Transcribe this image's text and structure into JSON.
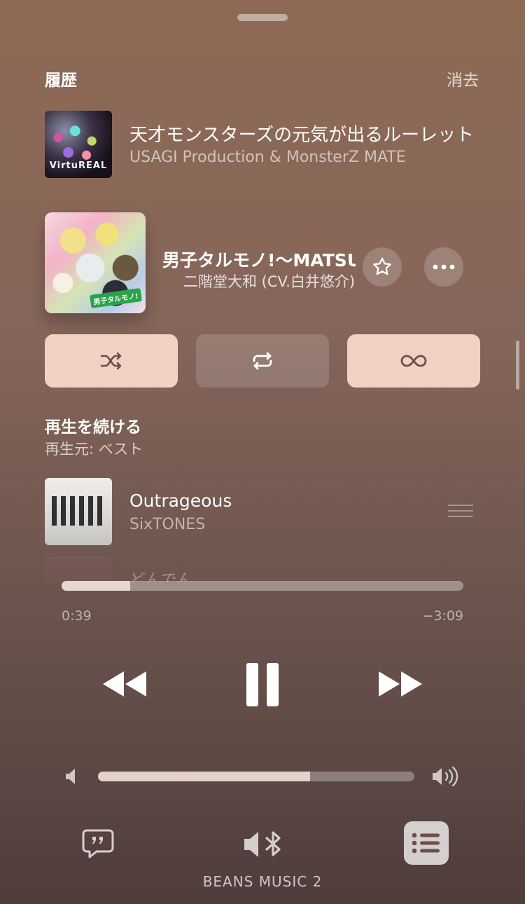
{
  "history": {
    "title": "履歴",
    "clear_label": "消去",
    "item": {
      "title": "天才モンスターズの元気が出るルーレット",
      "artist": "USAGI Production & MonsterZ MATE",
      "art_text": "VirtuREAL"
    }
  },
  "now_playing": {
    "title": "男子タルモノ!〜MATSURI〜",
    "artist": "二階堂大和 (CV.白井悠介)",
    "art_stamp": "男子タルモノ!"
  },
  "modes": {
    "shuffle": {
      "icon": "shuffle-icon",
      "active": true
    },
    "repeat": {
      "icon": "repeat-icon",
      "active": false
    },
    "autoplay": {
      "icon": "infinity-icon",
      "active": true
    }
  },
  "continue": {
    "title": "再生を続ける",
    "subtitle": "再生元: ベスト",
    "items": [
      {
        "title": "Outrageous",
        "artist": "SixTONES"
      },
      {
        "title": "どんでん"
      }
    ]
  },
  "playback": {
    "elapsed": "0:39",
    "remaining": "−3:09",
    "progress_fraction": 0.17
  },
  "volume": {
    "level_fraction": 0.67
  },
  "device": {
    "name": "BEANS MUSIC 2"
  },
  "colors": {
    "accent_button": "#efd2c4",
    "background_top": "#8e6a55",
    "background_bottom": "#4f3d3b"
  }
}
